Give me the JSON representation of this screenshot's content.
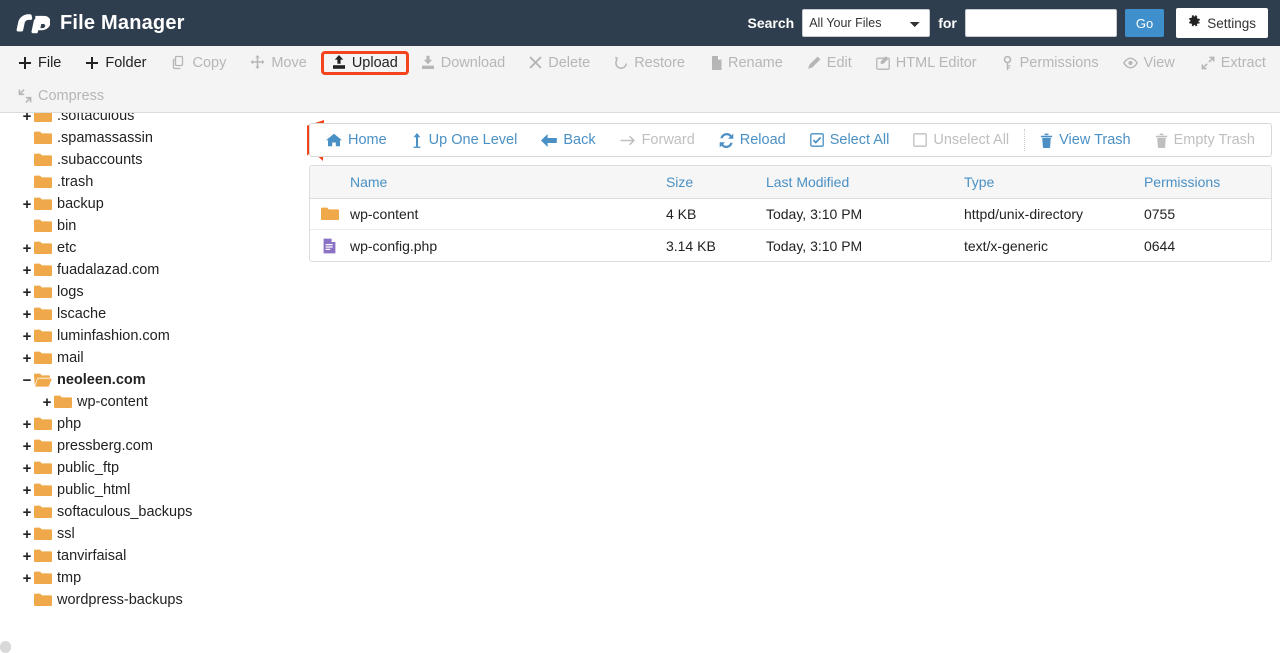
{
  "header": {
    "title": "File Manager",
    "logo_icon": "cpanel-logo-icon",
    "search_label": "Search",
    "search_scope_selected": "All Your Files",
    "search_scope_options": [
      "All Your Files"
    ],
    "for_label": "for",
    "search_value": "",
    "search_placeholder": "",
    "go_label": "Go",
    "settings_label": "Settings",
    "settings_icon": "gear-icon",
    "colors": {
      "bar_bg": "#2f3e4e",
      "go_button": "#3f8fcc"
    }
  },
  "toolbar": {
    "row1": [
      {
        "label": "File",
        "icon": "plus-icon",
        "enabled": true,
        "highlighted": false,
        "sep_after": false
      },
      {
        "label": "Folder",
        "icon": "plus-icon",
        "enabled": true,
        "highlighted": false,
        "sep_after": true
      },
      {
        "label": "Copy",
        "icon": "copy-icon",
        "enabled": false,
        "highlighted": false,
        "sep_after": false
      },
      {
        "label": "Move",
        "icon": "move-icon",
        "enabled": false,
        "highlighted": false,
        "sep_after": true
      },
      {
        "label": "Upload",
        "icon": "upload-icon",
        "enabled": true,
        "highlighted": true,
        "sep_after": false
      },
      {
        "label": "Download",
        "icon": "download-icon",
        "enabled": false,
        "highlighted": false,
        "sep_after": false
      },
      {
        "label": "Delete",
        "icon": "delete-x-icon",
        "enabled": false,
        "highlighted": false,
        "sep_after": false
      },
      {
        "label": "Restore",
        "icon": "restore-icon",
        "enabled": false,
        "highlighted": false,
        "sep_after": true
      },
      {
        "label": "Rename",
        "icon": "rename-file-icon",
        "enabled": false,
        "highlighted": false,
        "sep_after": false
      },
      {
        "label": "Edit",
        "icon": "pencil-icon",
        "enabled": false,
        "highlighted": false,
        "sep_after": false
      },
      {
        "label": "HTML Editor",
        "icon": "html-editor-icon",
        "enabled": false,
        "highlighted": false,
        "sep_after": false
      },
      {
        "label": "Permissions",
        "icon": "key-icon",
        "enabled": false,
        "highlighted": false,
        "sep_after": false
      },
      {
        "label": "View",
        "icon": "eye-icon",
        "enabled": false,
        "highlighted": false,
        "sep_after": true
      },
      {
        "label": "Extract",
        "icon": "extract-icon",
        "enabled": false,
        "highlighted": false,
        "sep_after": false
      }
    ],
    "row2": [
      {
        "label": "Compress",
        "icon": "compress-icon",
        "enabled": false,
        "highlighted": false,
        "sep_after": false
      }
    ]
  },
  "annotation": {
    "type": "arrow-pointing-to-upload-button",
    "target": "Upload",
    "color": "#f4441e"
  },
  "sidebar": {
    "tree": [
      {
        "label": ".softaculous",
        "state": "collapsed",
        "depth": 0,
        "active": false
      },
      {
        "label": ".spamassassin",
        "state": "leaf",
        "depth": 0,
        "active": false
      },
      {
        "label": ".subaccounts",
        "state": "leaf",
        "depth": 0,
        "active": false
      },
      {
        "label": ".trash",
        "state": "leaf",
        "depth": 0,
        "active": false
      },
      {
        "label": "backup",
        "state": "collapsed",
        "depth": 0,
        "active": false
      },
      {
        "label": "bin",
        "state": "leaf",
        "depth": 0,
        "active": false
      },
      {
        "label": "etc",
        "state": "collapsed",
        "depth": 0,
        "active": false
      },
      {
        "label": "fuadalazad.com",
        "state": "collapsed",
        "depth": 0,
        "active": false
      },
      {
        "label": "logs",
        "state": "collapsed",
        "depth": 0,
        "active": false
      },
      {
        "label": "lscache",
        "state": "collapsed",
        "depth": 0,
        "active": false
      },
      {
        "label": "luminfashion.com",
        "state": "collapsed",
        "depth": 0,
        "active": false
      },
      {
        "label": "mail",
        "state": "collapsed",
        "depth": 0,
        "active": false
      },
      {
        "label": "neoleen.com",
        "state": "expanded",
        "depth": 0,
        "active": true
      },
      {
        "label": "wp-content",
        "state": "collapsed",
        "depth": 1,
        "active": false
      },
      {
        "label": "php",
        "state": "collapsed",
        "depth": 0,
        "active": false
      },
      {
        "label": "pressberg.com",
        "state": "collapsed",
        "depth": 0,
        "active": false
      },
      {
        "label": "public_ftp",
        "state": "collapsed",
        "depth": 0,
        "active": false
      },
      {
        "label": "public_html",
        "state": "collapsed",
        "depth": 0,
        "active": false
      },
      {
        "label": "softaculous_backups",
        "state": "collapsed",
        "depth": 0,
        "active": false
      },
      {
        "label": "ssl",
        "state": "collapsed",
        "depth": 0,
        "active": false
      },
      {
        "label": "tanvirfaisal",
        "state": "collapsed",
        "depth": 0,
        "active": false
      },
      {
        "label": "tmp",
        "state": "collapsed",
        "depth": 0,
        "active": false
      },
      {
        "label": "wordpress-backups",
        "state": "leaf",
        "depth": 0,
        "active": false
      }
    ],
    "toggle_expanded": "−",
    "toggle_collapsed": "+"
  },
  "navbar": [
    {
      "label": "Home",
      "icon": "home-icon",
      "enabled": true,
      "sep_after": false
    },
    {
      "label": "Up One Level",
      "icon": "up-arrow-icon",
      "enabled": true,
      "sep_after": false
    },
    {
      "label": "Back",
      "icon": "back-arrow-icon",
      "enabled": true,
      "sep_after": false
    },
    {
      "label": "Forward",
      "icon": "forward-arrow-icon",
      "enabled": false,
      "sep_after": false
    },
    {
      "label": "Reload",
      "icon": "reload-icon",
      "enabled": true,
      "sep_after": false
    },
    {
      "label": "Select All",
      "icon": "checkbox-checked-icon",
      "enabled": true,
      "sep_after": false
    },
    {
      "label": "Unselect All",
      "icon": "checkbox-empty-icon",
      "enabled": false,
      "sep_after": true
    },
    {
      "label": "View Trash",
      "icon": "trash-icon",
      "enabled": true,
      "sep_after": false
    },
    {
      "label": "Empty Trash",
      "icon": "trash-icon",
      "enabled": false,
      "sep_after": false
    }
  ],
  "file_table": {
    "columns": [
      "Name",
      "Size",
      "Last Modified",
      "Type",
      "Permissions"
    ],
    "rows": [
      {
        "icon": "folder-icon",
        "name": "wp-content",
        "size": "4 KB",
        "last_modified": "Today, 3:10 PM",
        "type": "httpd/unix-directory",
        "permissions": "0755"
      },
      {
        "icon": "php-file-icon",
        "name": "wp-config.php",
        "size": "3.14 KB",
        "last_modified": "Today, 3:10 PM",
        "type": "text/x-generic",
        "permissions": "0644"
      }
    ]
  }
}
